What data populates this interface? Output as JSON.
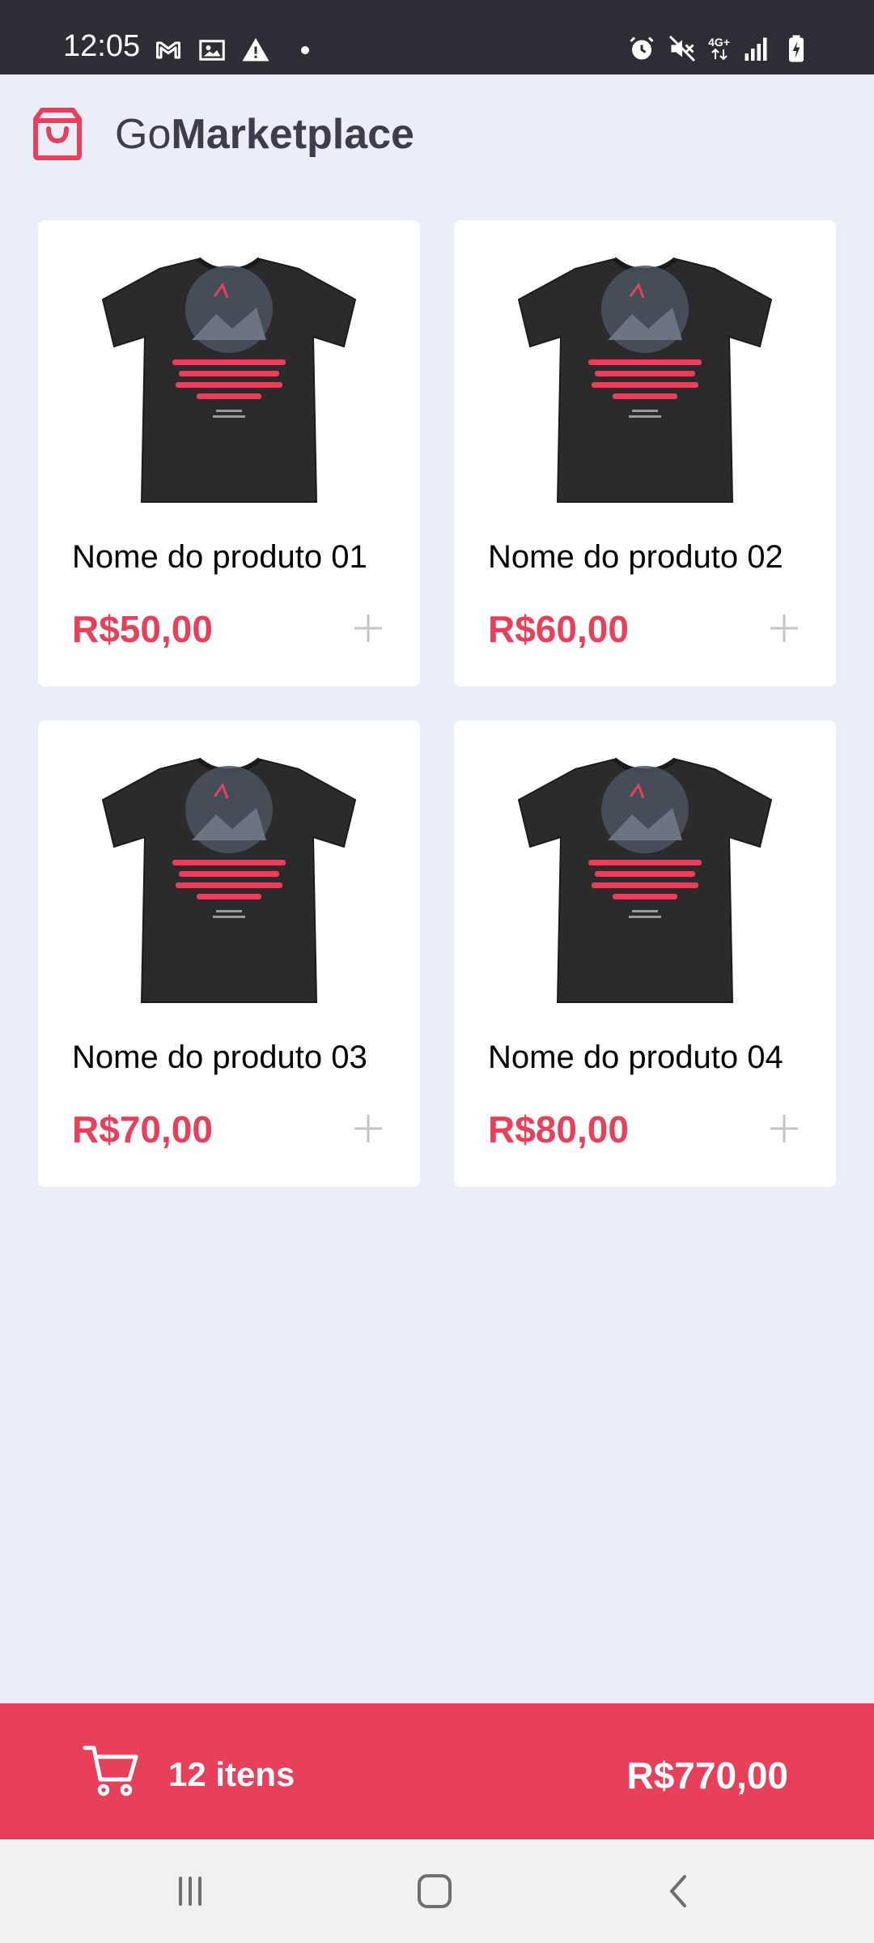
{
  "status_bar": {
    "time": "12:05",
    "network": "4G+",
    "icons_left": [
      "gmail-icon",
      "photo-icon",
      "warning-icon",
      "dot-icon"
    ],
    "icons_right": [
      "alarm-icon",
      "mute-icon",
      "network-4g-icon",
      "signal-icon",
      "battery-charging-icon"
    ]
  },
  "header": {
    "brand_part1": "Go",
    "brand_part2": "Marketplace",
    "logo_icon": "shopping-bag-icon"
  },
  "products": [
    {
      "title": "Nome do produto 01",
      "price": "R$50,00"
    },
    {
      "title": "Nome do produto 02",
      "price": "R$60,00"
    },
    {
      "title": "Nome do produto 03",
      "price": "R$70,00"
    },
    {
      "title": "Nome do produto 04",
      "price": "R$80,00"
    }
  ],
  "cart": {
    "count": "12 itens",
    "total": "R$770,00",
    "icon": "shopping-cart-icon"
  },
  "navigation": {
    "buttons": [
      "recents-icon",
      "home-icon",
      "back-icon"
    ]
  },
  "colors": {
    "accent": "#e83f5b",
    "background": "#ebeef8",
    "status_bar": "#2e2d35",
    "nav_bar": "#f1f1f1",
    "add_icon": "#c4c4c4",
    "brand_text": "#3d3d4d"
  }
}
